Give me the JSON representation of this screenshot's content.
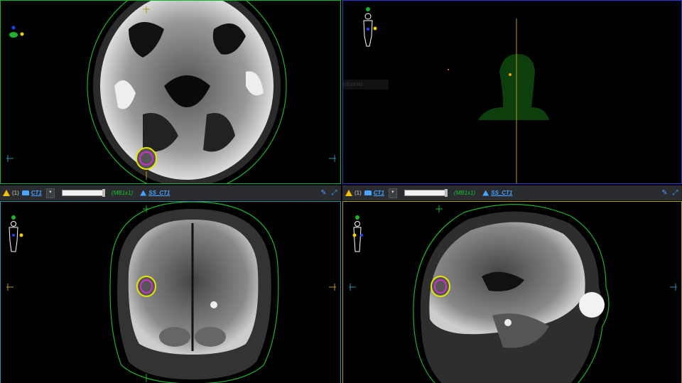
{
  "toolbars": [
    {
      "warn_count": "(1)",
      "ct_label": "CT1",
      "dropdown_glyph": "▾",
      "window_label": "(MB1x1)",
      "ss_label": "SS_CT1"
    },
    {
      "warn_count": "(1)",
      "ct_label": "CT1",
      "dropdown_glyph": "▾",
      "window_label": "(MB1x1)",
      "ss_label": "SS_CT1"
    }
  ],
  "tooltip": "Fully Contoured",
  "icons": {
    "warning": "warning-icon",
    "ct": "ct-icon",
    "ss": "structure-set-icon",
    "tool1": "draw-icon",
    "tool2": "maximize-icon"
  },
  "colors": {
    "axial_border": "#1db12d",
    "view3d_border": "#2b3cc4",
    "coronal_border": "#2f8fa8",
    "sagittal_border": "#b09a22",
    "contour_outer": "#e6e600",
    "contour_inner": "#d030d0",
    "skin_contour": "#1db12d"
  }
}
